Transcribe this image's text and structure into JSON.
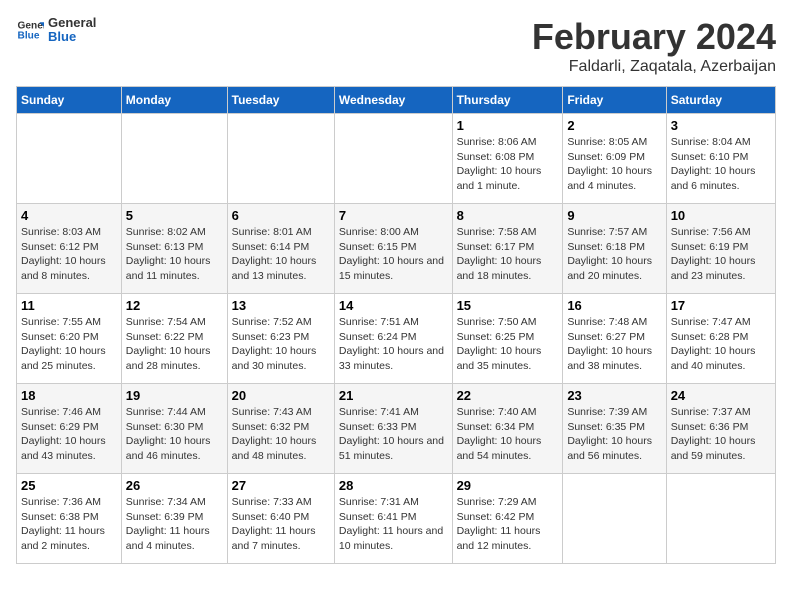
{
  "header": {
    "logo_general": "General",
    "logo_blue": "Blue",
    "title": "February 2024",
    "subtitle": "Faldarli, Zaqatala, Azerbaijan"
  },
  "days_of_week": [
    "Sunday",
    "Monday",
    "Tuesday",
    "Wednesday",
    "Thursday",
    "Friday",
    "Saturday"
  ],
  "weeks": [
    [
      {
        "day": "",
        "info": ""
      },
      {
        "day": "",
        "info": ""
      },
      {
        "day": "",
        "info": ""
      },
      {
        "day": "",
        "info": ""
      },
      {
        "day": "1",
        "info": "Sunrise: 8:06 AM\nSunset: 6:08 PM\nDaylight: 10 hours and 1 minute."
      },
      {
        "day": "2",
        "info": "Sunrise: 8:05 AM\nSunset: 6:09 PM\nDaylight: 10 hours and 4 minutes."
      },
      {
        "day": "3",
        "info": "Sunrise: 8:04 AM\nSunset: 6:10 PM\nDaylight: 10 hours and 6 minutes."
      }
    ],
    [
      {
        "day": "4",
        "info": "Sunrise: 8:03 AM\nSunset: 6:12 PM\nDaylight: 10 hours and 8 minutes."
      },
      {
        "day": "5",
        "info": "Sunrise: 8:02 AM\nSunset: 6:13 PM\nDaylight: 10 hours and 11 minutes."
      },
      {
        "day": "6",
        "info": "Sunrise: 8:01 AM\nSunset: 6:14 PM\nDaylight: 10 hours and 13 minutes."
      },
      {
        "day": "7",
        "info": "Sunrise: 8:00 AM\nSunset: 6:15 PM\nDaylight: 10 hours and 15 minutes."
      },
      {
        "day": "8",
        "info": "Sunrise: 7:58 AM\nSunset: 6:17 PM\nDaylight: 10 hours and 18 minutes."
      },
      {
        "day": "9",
        "info": "Sunrise: 7:57 AM\nSunset: 6:18 PM\nDaylight: 10 hours and 20 minutes."
      },
      {
        "day": "10",
        "info": "Sunrise: 7:56 AM\nSunset: 6:19 PM\nDaylight: 10 hours and 23 minutes."
      }
    ],
    [
      {
        "day": "11",
        "info": "Sunrise: 7:55 AM\nSunset: 6:20 PM\nDaylight: 10 hours and 25 minutes."
      },
      {
        "day": "12",
        "info": "Sunrise: 7:54 AM\nSunset: 6:22 PM\nDaylight: 10 hours and 28 minutes."
      },
      {
        "day": "13",
        "info": "Sunrise: 7:52 AM\nSunset: 6:23 PM\nDaylight: 10 hours and 30 minutes."
      },
      {
        "day": "14",
        "info": "Sunrise: 7:51 AM\nSunset: 6:24 PM\nDaylight: 10 hours and 33 minutes."
      },
      {
        "day": "15",
        "info": "Sunrise: 7:50 AM\nSunset: 6:25 PM\nDaylight: 10 hours and 35 minutes."
      },
      {
        "day": "16",
        "info": "Sunrise: 7:48 AM\nSunset: 6:27 PM\nDaylight: 10 hours and 38 minutes."
      },
      {
        "day": "17",
        "info": "Sunrise: 7:47 AM\nSunset: 6:28 PM\nDaylight: 10 hours and 40 minutes."
      }
    ],
    [
      {
        "day": "18",
        "info": "Sunrise: 7:46 AM\nSunset: 6:29 PM\nDaylight: 10 hours and 43 minutes."
      },
      {
        "day": "19",
        "info": "Sunrise: 7:44 AM\nSunset: 6:30 PM\nDaylight: 10 hours and 46 minutes."
      },
      {
        "day": "20",
        "info": "Sunrise: 7:43 AM\nSunset: 6:32 PM\nDaylight: 10 hours and 48 minutes."
      },
      {
        "day": "21",
        "info": "Sunrise: 7:41 AM\nSunset: 6:33 PM\nDaylight: 10 hours and 51 minutes."
      },
      {
        "day": "22",
        "info": "Sunrise: 7:40 AM\nSunset: 6:34 PM\nDaylight: 10 hours and 54 minutes."
      },
      {
        "day": "23",
        "info": "Sunrise: 7:39 AM\nSunset: 6:35 PM\nDaylight: 10 hours and 56 minutes."
      },
      {
        "day": "24",
        "info": "Sunrise: 7:37 AM\nSunset: 6:36 PM\nDaylight: 10 hours and 59 minutes."
      }
    ],
    [
      {
        "day": "25",
        "info": "Sunrise: 7:36 AM\nSunset: 6:38 PM\nDaylight: 11 hours and 2 minutes."
      },
      {
        "day": "26",
        "info": "Sunrise: 7:34 AM\nSunset: 6:39 PM\nDaylight: 11 hours and 4 minutes."
      },
      {
        "day": "27",
        "info": "Sunrise: 7:33 AM\nSunset: 6:40 PM\nDaylight: 11 hours and 7 minutes."
      },
      {
        "day": "28",
        "info": "Sunrise: 7:31 AM\nSunset: 6:41 PM\nDaylight: 11 hours and 10 minutes."
      },
      {
        "day": "29",
        "info": "Sunrise: 7:29 AM\nSunset: 6:42 PM\nDaylight: 11 hours and 12 minutes."
      },
      {
        "day": "",
        "info": ""
      },
      {
        "day": "",
        "info": ""
      }
    ]
  ]
}
